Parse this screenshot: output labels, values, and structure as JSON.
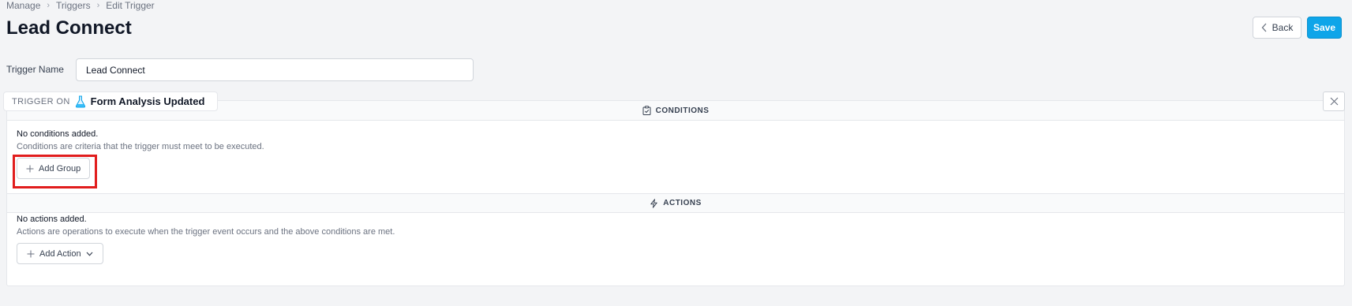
{
  "breadcrumb": {
    "items": [
      "Manage",
      "Triggers",
      "Edit Trigger"
    ]
  },
  "header": {
    "title": "Lead Connect",
    "back_label": "Back",
    "save_label": "Save"
  },
  "form": {
    "trigger_name_label": "Trigger Name",
    "trigger_name_value": "Lead Connect"
  },
  "trigger_on": {
    "label": "TRIGGER ON",
    "event": "Form Analysis Updated",
    "icon": "flask-icon"
  },
  "conditions": {
    "heading": "CONDITIONS",
    "empty_title": "No conditions added.",
    "empty_desc": "Conditions are criteria that the trigger must meet to be executed.",
    "add_label": "Add Group"
  },
  "actions": {
    "heading": "ACTIONS",
    "empty_title": "No actions added.",
    "empty_desc": "Actions are operations to execute when the trigger event occurs and the above conditions are met.",
    "add_label": "Add Action"
  },
  "colors": {
    "accent": "#0ea5e9",
    "highlight": "#e11d1d",
    "background": "#f3f4f6"
  }
}
